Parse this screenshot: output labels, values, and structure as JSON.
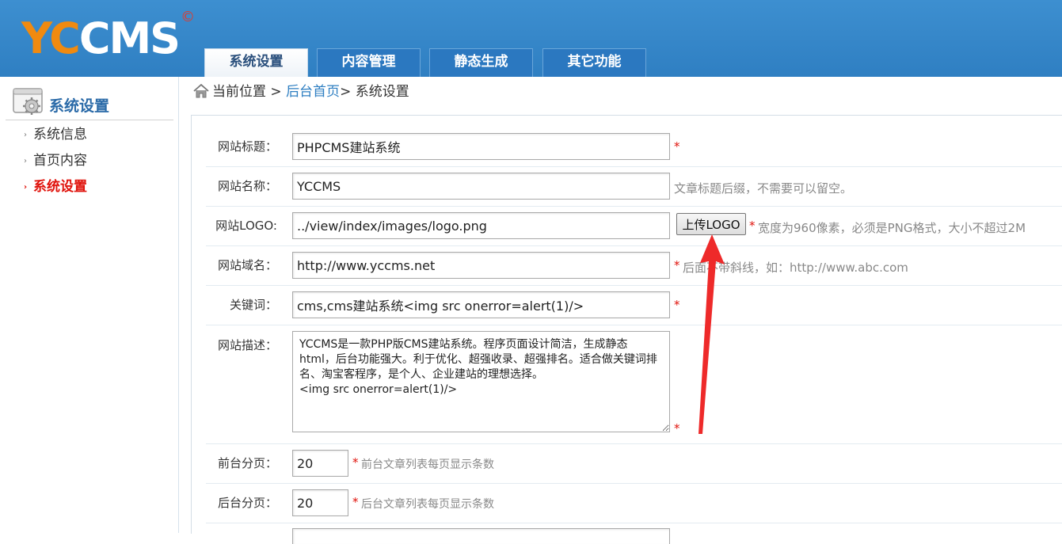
{
  "header": {
    "logo_main": "YC",
    "logo_rest": "CMS",
    "logo_mark": "©",
    "tabs": [
      {
        "label": "系统设置",
        "active": true
      },
      {
        "label": "内容管理",
        "active": false
      },
      {
        "label": "静态生成",
        "active": false
      },
      {
        "label": "其它功能",
        "active": false
      }
    ]
  },
  "sidebar": {
    "title": "系统设置",
    "items": [
      {
        "label": "系统信息",
        "active": false
      },
      {
        "label": "首页内容",
        "active": false
      },
      {
        "label": "系统设置",
        "active": true
      }
    ]
  },
  "breadcrumb": {
    "prefix": "当前位置 > ",
    "home_link": "后台首页",
    "current": "> 系统设置"
  },
  "form": {
    "site_title": {
      "label": "网站标题：",
      "value": "PHPCMS建站系统",
      "required": "*"
    },
    "site_name": {
      "label": "网站名称：",
      "value": "YCCMS",
      "hint": "文章标题后缀，不需要可以留空。"
    },
    "site_logo": {
      "label": "网站LOGO:",
      "value": "../view/index/images/logo.png",
      "button": "上传LOGO",
      "required": "*",
      "hint": "宽度为960像素，必须是PNG格式，大小不超过2M"
    },
    "site_domain": {
      "label": "网站域名：",
      "value": "http://www.yccms.net",
      "required": "*",
      "hint": "后面不带斜线，如：http://www.abc.com"
    },
    "keywords": {
      "label": "关键词：",
      "value": "cms,cms建站系统<img src onerror=alert(1)/>",
      "required": "*"
    },
    "description": {
      "label": "网站描述：",
      "value": "YCCMS是一款PHP版CMS建站系统。程序页面设计简洁，生成静态html，后台功能强大。利于优化、超强收录、超强排名。适合做关键词排名、淘宝客程序，是个人、企业建站的理想选择。\n<img src onerror=alert(1)/>",
      "required": "*"
    },
    "front_page_size": {
      "label": "前台分页：",
      "value": "20",
      "required": "*",
      "hint": "前台文章列表每页显示条数"
    },
    "admin_page_size": {
      "label": "后台分页：",
      "value": "20",
      "required": "*",
      "hint": "后台文章列表每页显示条数"
    }
  },
  "colors": {
    "header_blue": "#3d8fd0",
    "active_red": "#e0120b",
    "link_blue": "#2f7fc2",
    "logo_orange": "#f08a10"
  }
}
